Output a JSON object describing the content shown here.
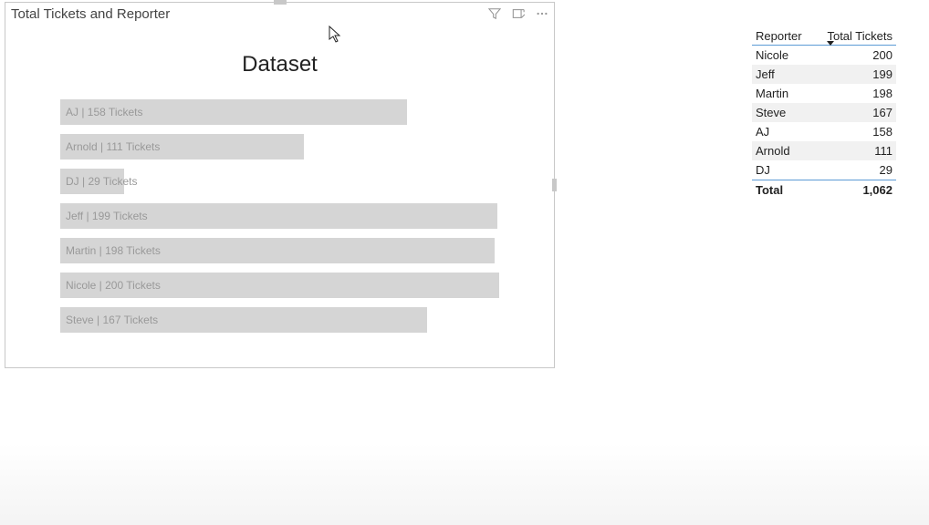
{
  "visual": {
    "title": "Total Tickets and Reporter",
    "chart_title": "Dataset"
  },
  "chart_data": {
    "type": "bar",
    "orientation": "horizontal",
    "title": "Dataset",
    "xlabel": "",
    "ylabel": "",
    "categories": [
      "AJ",
      "Arnold",
      "DJ",
      "Jeff",
      "Martin",
      "Nicole",
      "Steve"
    ],
    "values": [
      158,
      111,
      29,
      199,
      198,
      200,
      167
    ],
    "bar_labels": [
      "AJ | 158 Tickets",
      "Arnold | 111 Tickets",
      "DJ | 29 Tickets",
      "Jeff | 199 Tickets",
      "Martin | 198 Tickets",
      "Nicole | 200 Tickets",
      "Steve | 167 Tickets"
    ],
    "xlim": [
      0,
      200
    ]
  },
  "table": {
    "headers": {
      "reporter": "Reporter",
      "total": "Total Tickets"
    },
    "rows": [
      {
        "reporter": "Nicole",
        "total": "200"
      },
      {
        "reporter": "Jeff",
        "total": "199"
      },
      {
        "reporter": "Martin",
        "total": "198"
      },
      {
        "reporter": "Steve",
        "total": "167"
      },
      {
        "reporter": "AJ",
        "total": "158"
      },
      {
        "reporter": "Arnold",
        "total": "111"
      },
      {
        "reporter": "DJ",
        "total": "29"
      }
    ],
    "total_label": "Total",
    "total_value": "1,062",
    "sort_column": "Total Tickets",
    "sort_direction": "desc"
  }
}
